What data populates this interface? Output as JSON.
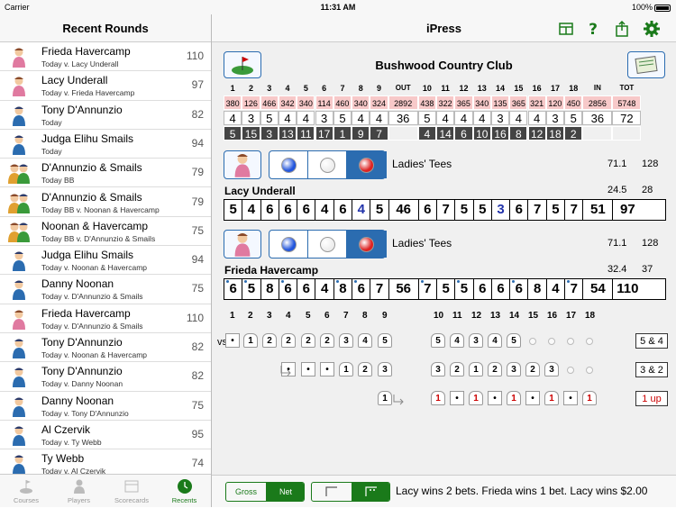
{
  "status": {
    "carrier": "Carrier",
    "time": "11:31 AM",
    "battery": "100%"
  },
  "sidebar": {
    "title": "Recent Rounds",
    "rounds": [
      {
        "name": "Frieda Havercamp",
        "sub": "Today v. Lacy Underall",
        "score": "110",
        "avatar": "female"
      },
      {
        "name": "Lacy Underall",
        "sub": "Today v. Frieda Havercamp",
        "score": "97",
        "avatar": "female"
      },
      {
        "name": "Tony D'Annunzio",
        "sub": "Today",
        "score": "82",
        "avatar": "male"
      },
      {
        "name": "Judga Elihu Smails",
        "sub": "Today",
        "score": "94",
        "avatar": "male"
      },
      {
        "name": "D'Annunzio & Smails",
        "sub": "Today BB",
        "score": "79",
        "avatar": "pair"
      },
      {
        "name": "D'Annunzio & Smails",
        "sub": "Today BB v. Noonan & Havercamp",
        "score": "79",
        "avatar": "pair"
      },
      {
        "name": "Noonan & Havercamp",
        "sub": "Today BB v. D'Annunzio & Smails",
        "score": "75",
        "avatar": "pair"
      },
      {
        "name": "Judga Elihu Smails",
        "sub": "Today v. Noonan & Havercamp",
        "score": "94",
        "avatar": "male"
      },
      {
        "name": "Danny Noonan",
        "sub": "Today v. D'Annunzio & Smails",
        "score": "75",
        "avatar": "male"
      },
      {
        "name": "Frieda Havercamp",
        "sub": "Today v. D'Annunzio & Smails",
        "score": "110",
        "avatar": "female"
      },
      {
        "name": "Tony D'Annunzio",
        "sub": "Today v. Noonan & Havercamp",
        "score": "82",
        "avatar": "male"
      },
      {
        "name": "Tony D'Annunzio",
        "sub": "Today v. Danny Noonan",
        "score": "82",
        "avatar": "male"
      },
      {
        "name": "Danny Noonan",
        "sub": "Today v. Tony D'Annunzio",
        "score": "75",
        "avatar": "male"
      },
      {
        "name": "Al Czervik",
        "sub": "Today v. Ty Webb",
        "score": "95",
        "avatar": "male"
      },
      {
        "name": "Ty Webb",
        "sub": "Today v. Al Czervik",
        "score": "74",
        "avatar": "male"
      }
    ]
  },
  "tabs": [
    {
      "label": "Courses"
    },
    {
      "label": "Players"
    },
    {
      "label": "Scorecards"
    },
    {
      "label": "Recents"
    }
  ],
  "nav": {
    "title": "iPress",
    "icons": [
      "grid-icon",
      "help-icon",
      "share-icon",
      "gear-icon"
    ]
  },
  "course": {
    "name": "Bushwood Country Club",
    "holes": [
      "1",
      "2",
      "3",
      "4",
      "5",
      "6",
      "7",
      "8",
      "9",
      "OUT",
      "10",
      "11",
      "12",
      "13",
      "14",
      "15",
      "16",
      "17",
      "18",
      "IN",
      "TOT"
    ],
    "yards": [
      "380",
      "126",
      "466",
      "342",
      "340",
      "114",
      "460",
      "340",
      "324",
      "2892",
      "438",
      "322",
      "365",
      "340",
      "135",
      "365",
      "321",
      "120",
      "450",
      "2856",
      "5748"
    ],
    "par": [
      "4",
      "3",
      "5",
      "4",
      "4",
      "3",
      "5",
      "4",
      "4",
      "36",
      "5",
      "4",
      "4",
      "4",
      "3",
      "4",
      "4",
      "3",
      "5",
      "36",
      "72"
    ],
    "hcp": [
      "5",
      "15",
      "3",
      "13",
      "11",
      "17",
      "1",
      "9",
      "7",
      "",
      "4",
      "14",
      "6",
      "10",
      "16",
      "8",
      "12",
      "18",
      "2",
      "",
      ""
    ]
  },
  "players": [
    {
      "tees": "Ladies' Tees",
      "rating": "71.1",
      "slope": "128",
      "name": "Lacy Underall",
      "hcp": "24.5",
      "course_hcp": "28",
      "scores": [
        "5",
        "4",
        "6",
        "6",
        "6",
        "4",
        "6",
        "4",
        "5",
        "46",
        "6",
        "7",
        "5",
        "5",
        "3",
        "6",
        "7",
        "5",
        "7",
        "51",
        "97"
      ],
      "blue": [
        7,
        14
      ],
      "dots": []
    },
    {
      "tees": "Ladies' Tees",
      "rating": "71.1",
      "slope": "128",
      "name": "Frieda Havercamp",
      "hcp": "32.4",
      "course_hcp": "37",
      "scores": [
        "6",
        "5",
        "8",
        "6",
        "6",
        "4",
        "8",
        "6",
        "7",
        "56",
        "7",
        "5",
        "5",
        "6",
        "6",
        "6",
        "8",
        "4",
        "7",
        "54",
        "110"
      ],
      "blue": [],
      "dots": [
        0,
        1,
        3,
        6,
        7,
        10,
        12,
        15,
        18
      ]
    }
  ],
  "match": {
    "vs": "vs.",
    "front_labels": [
      "1",
      "2",
      "3",
      "4",
      "5",
      "6",
      "7",
      "8",
      "9"
    ],
    "back_labels": [
      "10",
      "11",
      "12",
      "13",
      "14",
      "15",
      "16",
      "17",
      "18"
    ],
    "bets": [
      {
        "front": [
          "•",
          "1",
          "2",
          "2",
          "2",
          "2",
          "3",
          "4",
          "5"
        ],
        "back": [
          "5",
          "4",
          "3",
          "4",
          "5",
          "",
          "",
          "",
          ""
        ],
        "result": "5 & 4",
        "red": false
      },
      {
        "front": [
          "",
          "",
          "",
          "•",
          "•",
          "•",
          "1",
          "2",
          "3"
        ],
        "back": [
          "3",
          "2",
          "1",
          "2",
          "3",
          "2",
          "3",
          "",
          ""
        ],
        "result": "3 & 2",
        "red": false
      },
      {
        "front": [
          "",
          "",
          "",
          "",
          "",
          "",
          "",
          "",
          "1"
        ],
        "back": [
          "1",
          "•",
          "1",
          "•",
          "1",
          "•",
          "1",
          "•",
          "1"
        ],
        "result": "1 up",
        "red": true
      }
    ]
  },
  "bottom": {
    "gross": "Gross",
    "net": "Net",
    "summary": "Lacy wins 2 bets.  Frieda wins 1 bet.  Lacy wins $2.00"
  }
}
